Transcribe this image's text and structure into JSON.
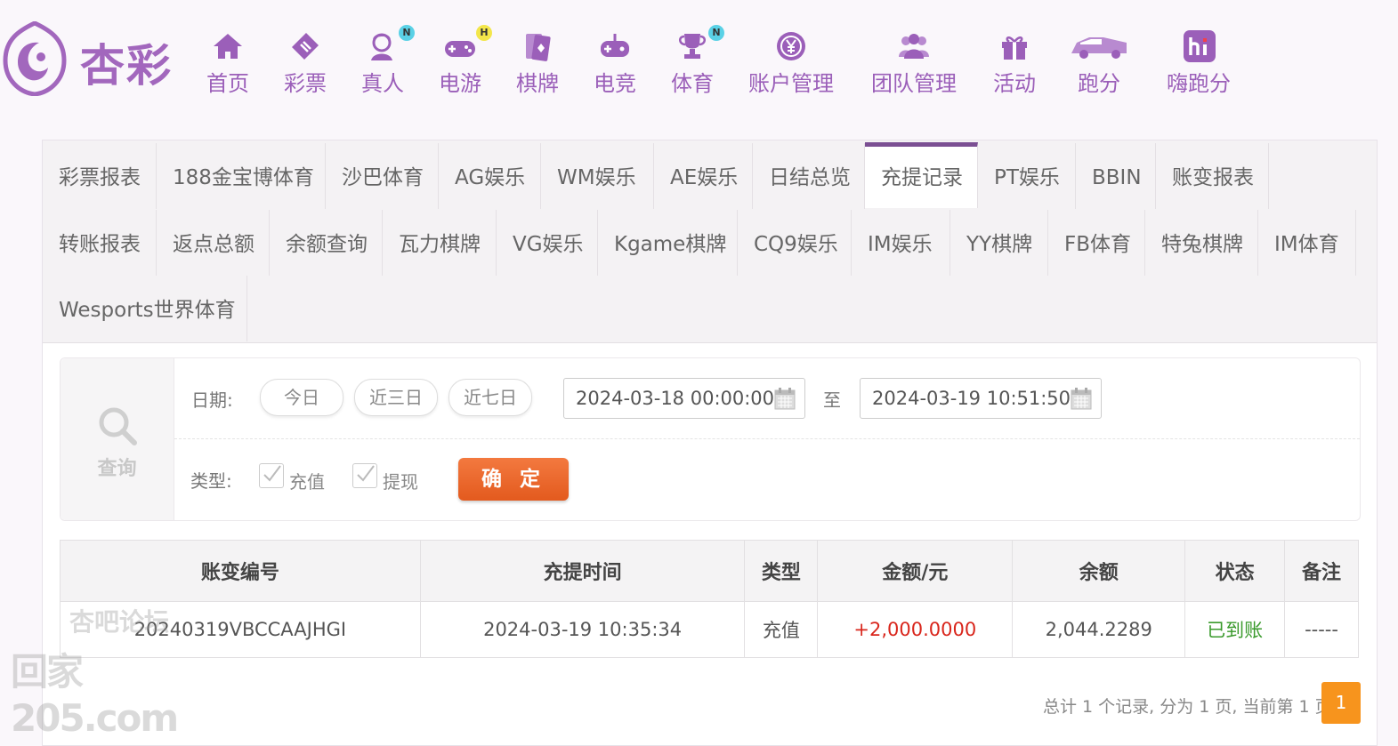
{
  "logo": {
    "text": "杏彩"
  },
  "nav": [
    {
      "label": "首页",
      "icon": "home-icon",
      "badge": ""
    },
    {
      "label": "彩票",
      "icon": "lottery-ticket-icon",
      "badge": ""
    },
    {
      "label": "真人",
      "icon": "live-dealer-icon",
      "badge": "N"
    },
    {
      "label": "电游",
      "icon": "gamepad-icon",
      "badge": "H"
    },
    {
      "label": "棋牌",
      "icon": "playing-cards-icon",
      "badge": ""
    },
    {
      "label": "电竞",
      "icon": "esports-controller-icon",
      "badge": ""
    },
    {
      "label": "体育",
      "icon": "trophy-icon",
      "badge": "N"
    },
    {
      "label": "账户管理",
      "icon": "yen-coin-icon",
      "badge": ""
    },
    {
      "label": "团队管理",
      "icon": "team-icon",
      "badge": ""
    },
    {
      "label": "活动",
      "icon": "gift-icon",
      "badge": ""
    },
    {
      "label": "跑分",
      "icon": "running-car-icon",
      "badge": ""
    },
    {
      "label": "嗨跑分",
      "icon": "hi-app-icon",
      "badge": ""
    }
  ],
  "tabs": {
    "row1": [
      "彩票报表",
      "188金宝博体育",
      "沙巴体育",
      "AG娱乐",
      "WM娱乐",
      "AE娱乐",
      "日结总览",
      "充提记录",
      "PT娱乐",
      "BBIN",
      "账变报表"
    ],
    "row2": [
      "转账报表",
      "返点总额",
      "余额查询",
      "瓦力棋牌",
      "VG娱乐",
      "Kgame棋牌",
      "CQ9娱乐",
      "IM娱乐",
      "YY棋牌",
      "FB体育",
      "特兔棋牌",
      "IM体育"
    ],
    "row3": [
      "Wesports世界体育"
    ],
    "active": "充提记录"
  },
  "filter": {
    "query_label": "查询",
    "date_label": "日期:",
    "quick_ranges": [
      "今日",
      "近三日",
      "近七日"
    ],
    "start_date": "2024-03-18 00:00:00",
    "to_label": "至",
    "end_date": "2024-03-19 10:51:50",
    "type_label": "类型:",
    "types": [
      "充值",
      "提现"
    ],
    "confirm_label": "确 定"
  },
  "table": {
    "headers": [
      "账变编号",
      "充提时间",
      "类型",
      "金额/元",
      "余额",
      "状态",
      "备注"
    ],
    "rows": [
      {
        "id": "20240319VBCCAAJHGI",
        "time": "2024-03-19 10:35:34",
        "type": "充值",
        "amount": "+2,000.0000",
        "balance": "2,044.2289",
        "status": "已到账",
        "remark": "-----"
      }
    ]
  },
  "pager": {
    "summary": "总计 1 个记录, 分为 1 页, 当前第 1 页",
    "current_page": "1"
  },
  "watermark": {
    "line1": "杏吧论坛",
    "line2": "回家205.com"
  },
  "colors": {
    "brand_purple": "#9b5fb9",
    "active_tab_border": "#7b4f93",
    "confirm_button": "#e8642a",
    "amount_positive": "#d9261c",
    "status_success": "#3a9a2c",
    "page_button": "#f7941d"
  }
}
